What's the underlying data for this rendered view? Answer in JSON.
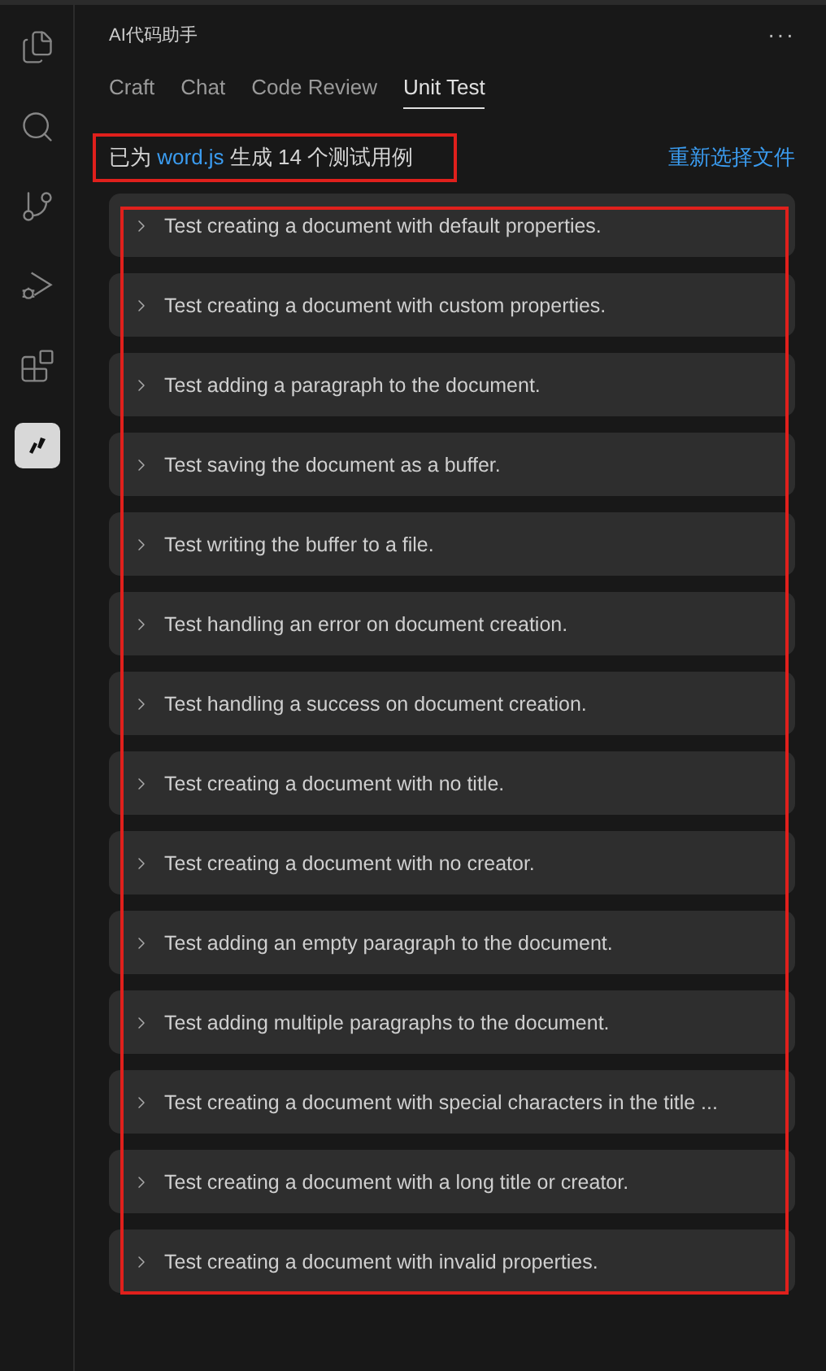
{
  "activity_bar": {
    "items": [
      {
        "kind": "files",
        "selected": false
      },
      {
        "kind": "search",
        "selected": false
      },
      {
        "kind": "source-control",
        "selected": false
      },
      {
        "kind": "run-debug",
        "selected": false
      },
      {
        "kind": "extensions",
        "selected": false
      },
      {
        "kind": "assistant",
        "selected": true
      }
    ]
  },
  "panel": {
    "title": "AI代码助手",
    "more": "···"
  },
  "tabs": [
    {
      "label": "Craft",
      "selected": false
    },
    {
      "label": "Chat",
      "selected": false
    },
    {
      "label": "Code Review",
      "selected": false
    },
    {
      "label": "Unit Test",
      "selected": true
    }
  ],
  "summary": {
    "text_before": "已为",
    "file": "word.js",
    "text_after": "生成 14 个测试用例",
    "highlighted": true
  },
  "reselect_link": "重新选择文件",
  "tests_highlighted": true,
  "tests": [
    {
      "title": "Test creating a document with default properties.",
      "expanded": false
    },
    {
      "title": "Test creating a document with custom properties.",
      "expanded": false
    },
    {
      "title": "Test adding a paragraph to the document.",
      "expanded": false
    },
    {
      "title": "Test saving the document as a buffer.",
      "expanded": false
    },
    {
      "title": "Test writing the buffer to a file.",
      "expanded": false
    },
    {
      "title": "Test handling an error on document creation.",
      "expanded": false
    },
    {
      "title": "Test handling a success on document creation.",
      "expanded": false
    },
    {
      "title": "Test creating a document with no title.",
      "expanded": false
    },
    {
      "title": "Test creating a document with no creator.",
      "expanded": false
    },
    {
      "title": "Test adding an empty paragraph to the document.",
      "expanded": false
    },
    {
      "title": "Test adding multiple paragraphs to the document.",
      "expanded": false
    },
    {
      "title": "Test creating a document with special characters in the title ...",
      "expanded": false
    },
    {
      "title": "Test creating a document with a long title or creator.",
      "expanded": false
    },
    {
      "title": "Test creating a document with invalid properties.",
      "expanded": false
    }
  ]
}
